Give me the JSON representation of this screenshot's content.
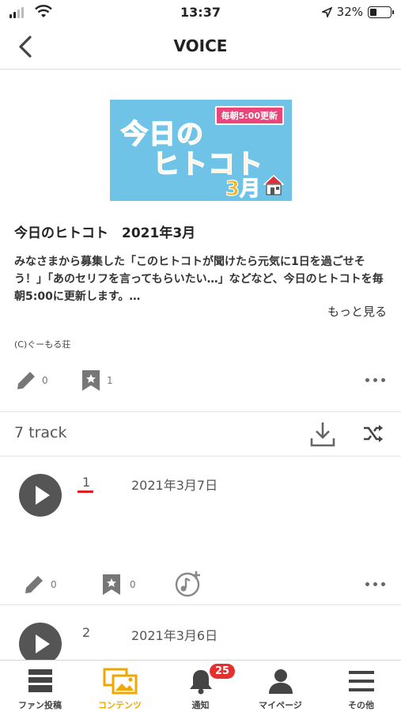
{
  "status": {
    "time": "13:37",
    "battery": "32%",
    "battery_level": 0.32
  },
  "nav": {
    "title": "VOICE"
  },
  "banner": {
    "tag": "毎朝5:00更新",
    "line1": "今日の",
    "line2": "ヒトコト",
    "line3": "3月"
  },
  "post": {
    "title": "今日のヒトコト　2021年3月",
    "description": "みなさまから募集した「このヒトコトが聞けたら元気に1日を過ごせそう！」「あのセリフを言ってもらいたい…」などなど、今日のヒトコトを毎朝5:00に更新します。…",
    "more": "もっと見る",
    "copyright": "(C)ぐーもる荘",
    "comment_count": "0",
    "bookmark_count": "1"
  },
  "tracks_header": {
    "label": "7 track"
  },
  "tracks": [
    {
      "number": "1",
      "date": "2021年3月7日",
      "comment_count": "0",
      "bookmark_count": "0"
    },
    {
      "number": "2",
      "date": "2021年3月6日"
    }
  ],
  "tabbar": {
    "items": [
      {
        "label": "ファン投稿",
        "icon": "fan-post-icon"
      },
      {
        "label": "コンテンツ",
        "icon": "contents-icon"
      },
      {
        "label": "通知",
        "icon": "bell-icon",
        "badge": "25"
      },
      {
        "label": "マイページ",
        "icon": "person-icon"
      },
      {
        "label": "その他",
        "icon": "menu-icon"
      }
    ],
    "active_color": "#f0a800"
  }
}
